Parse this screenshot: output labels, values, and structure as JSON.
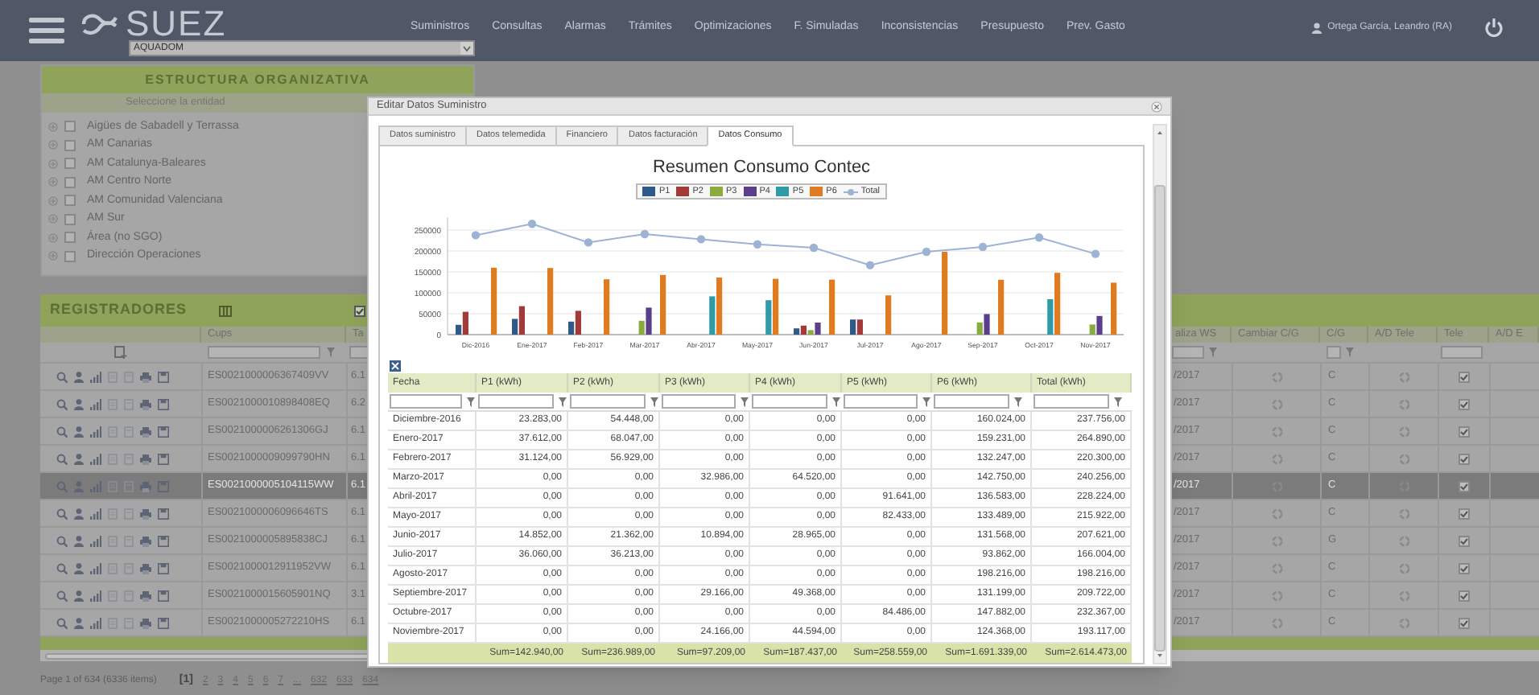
{
  "header": {
    "brand": "SUEZ",
    "org_select": "AQUADOM",
    "nav": [
      "Suministros",
      "Consultas",
      "Alarmas",
      "Trámites",
      "Optimizaciones",
      "F. Simuladas",
      "Inconsistencias",
      "Presupuesto",
      "Prev. Gasto"
    ],
    "user": "Ortega García, Leandro (RA)"
  },
  "org_panel": {
    "title": "ESTRUCTURA ORGANIZATIVA",
    "subtitle": "Seleccione la entidad",
    "items": [
      {
        "label": "Aigües de Sabadell y Terrassa",
        "checked": false
      },
      {
        "label": "AM Canarias",
        "checked": false
      },
      {
        "label": "AM Catalunya-Baleares",
        "checked": false
      },
      {
        "label": "AM Centro Norte",
        "checked": false
      },
      {
        "label": "AM Comunidad Valenciana",
        "checked": false
      },
      {
        "label": "AM Sur",
        "checked": false
      },
      {
        "label": "Área (no SGO)",
        "checked": false
      },
      {
        "label": "Dirección Operaciones",
        "checked": false
      }
    ]
  },
  "registradores": {
    "title": "REGISTRADORES",
    "cups_filter_checked": true,
    "columns": [
      "Cups",
      "Ta",
      "aliza WS",
      "Cambiar C/G",
      "C/G",
      "A/D Tele",
      "Tele",
      "A/D E"
    ],
    "rows": [
      {
        "cups": "ES0021000006367409VV",
        "ta": "6.1",
        "date": "/2017",
        "cg": "C",
        "tele": true,
        "selected": false
      },
      {
        "cups": "ES0021000010898408EQ",
        "ta": "6.2",
        "date": "/2017",
        "cg": "C",
        "tele": true,
        "selected": false
      },
      {
        "cups": "ES0021000006261306GJ",
        "ta": "6.1",
        "date": "/2017",
        "cg": "C",
        "tele": true,
        "selected": false
      },
      {
        "cups": "ES0021000009099790HN",
        "ta": "6.1",
        "date": "/2017",
        "cg": "C",
        "tele": true,
        "selected": false
      },
      {
        "cups": "ES0021000005104115WW",
        "ta": "6.1",
        "date": "/2017",
        "cg": "C",
        "tele": true,
        "selected": true
      },
      {
        "cups": "ES0021000006096646TS",
        "ta": "6.1",
        "date": "/2017",
        "cg": "C",
        "tele": true,
        "selected": false
      },
      {
        "cups": "ES0021000005895838CJ",
        "ta": "6.1",
        "date": "/2017",
        "cg": "G",
        "tele": true,
        "selected": false
      },
      {
        "cups": "ES0021000012911952VW",
        "ta": "6.1",
        "date": "/2017",
        "cg": "C",
        "tele": true,
        "selected": false
      },
      {
        "cups": "ES0021000015605901NQ",
        "ta": "3.1",
        "date": "/2017",
        "cg": "C",
        "tele": true,
        "selected": false
      },
      {
        "cups": "ES0021000005272210HS",
        "ta": "6.1",
        "date": "/2017",
        "cg": "C",
        "tele": true,
        "selected": false
      }
    ],
    "pagination": {
      "summary": "Page 1 of 634 (6336 items)",
      "pages": [
        {
          "label": "[1]",
          "selected": true
        },
        {
          "label": "2",
          "selected": false
        },
        {
          "label": "3",
          "selected": false
        },
        {
          "label": "4",
          "selected": false
        },
        {
          "label": "5",
          "selected": false
        },
        {
          "label": "6",
          "selected": false
        },
        {
          "label": "7",
          "selected": false
        },
        {
          "label": "...",
          "selected": false
        },
        {
          "label": "632",
          "selected": false
        },
        {
          "label": "633",
          "selected": false
        },
        {
          "label": "634",
          "selected": false
        }
      ]
    }
  },
  "dialog": {
    "title": "Editar Datos Suministro",
    "tabs": [
      {
        "label": "Datos suministro",
        "selected": false
      },
      {
        "label": "Datos telemedida",
        "selected": false
      },
      {
        "label": "Financiero",
        "selected": false
      },
      {
        "label": "Datos facturación",
        "selected": false
      },
      {
        "label": "Datos Consumo",
        "selected": true
      }
    ],
    "chart_data": {
      "type": "bar",
      "title": "Resumen Consumo Contec",
      "categories": [
        "Dic-2016",
        "Ene-2017",
        "Feb-2017",
        "Mar-2017",
        "Abr-2017",
        "May-2017",
        "Jun-2017",
        "Jul-2017",
        "Ago-2017",
        "Sep-2017",
        "Oct-2017",
        "Nov-2017"
      ],
      "stacked": false,
      "grid": true,
      "legend": "top",
      "ylim": [
        0,
        280000
      ],
      "yticks": [
        0,
        50000,
        100000,
        150000,
        200000,
        250000
      ],
      "series": [
        {
          "name": "P1",
          "color": "#2e5a8a",
          "values": [
            23283,
            37612,
            31124,
            0,
            0,
            0,
            14852,
            36060,
            0,
            0,
            0,
            0
          ]
        },
        {
          "name": "P2",
          "color": "#a33a3a",
          "values": [
            54448,
            68047,
            56929,
            0,
            0,
            0,
            21362,
            36213,
            0,
            0,
            0,
            0
          ]
        },
        {
          "name": "P3",
          "color": "#8aab3d",
          "values": [
            0,
            0,
            0,
            32986,
            0,
            0,
            10894,
            0,
            0,
            29166,
            0,
            24166
          ]
        },
        {
          "name": "P4",
          "color": "#5b3f8a",
          "values": [
            0,
            0,
            0,
            64520,
            0,
            0,
            28965,
            0,
            0,
            49368,
            0,
            44594
          ]
        },
        {
          "name": "P5",
          "color": "#2f9aa8",
          "values": [
            0,
            0,
            0,
            0,
            91641,
            82433,
            0,
            0,
            0,
            0,
            84486,
            0
          ]
        },
        {
          "name": "P6",
          "color": "#e07b22",
          "values": [
            160024,
            159231,
            132247,
            142750,
            136583,
            133489,
            131568,
            93862,
            198216,
            131199,
            147882,
            124368
          ]
        },
        {
          "name": "Total",
          "color": "#9db3d4",
          "type": "line",
          "marker": "circle",
          "values": [
            237756,
            264890,
            220300,
            240256,
            228224,
            215922,
            207621,
            166004,
            198216,
            209722,
            232367,
            193117
          ]
        }
      ]
    },
    "table": {
      "columns": [
        "Fecha",
        "P1 (kWh)",
        "P2 (kWh)",
        "P3 (kWh)",
        "P4 (kWh)",
        "P5 (kWh)",
        "P6 (kWh)",
        "Total (kWh)"
      ],
      "rows": [
        [
          "Diciembre-2016",
          "23.283,00",
          "54.448,00",
          "0,00",
          "0,00",
          "0,00",
          "160.024,00",
          "237.756,00"
        ],
        [
          "Enero-2017",
          "37.612,00",
          "68.047,00",
          "0,00",
          "0,00",
          "0,00",
          "159.231,00",
          "264.890,00"
        ],
        [
          "Febrero-2017",
          "31.124,00",
          "56.929,00",
          "0,00",
          "0,00",
          "0,00",
          "132.247,00",
          "220.300,00"
        ],
        [
          "Marzo-2017",
          "0,00",
          "0,00",
          "32.986,00",
          "64.520,00",
          "0,00",
          "142.750,00",
          "240.256,00"
        ],
        [
          "Abril-2017",
          "0,00",
          "0,00",
          "0,00",
          "0,00",
          "91.641,00",
          "136.583,00",
          "228.224,00"
        ],
        [
          "Mayo-2017",
          "0,00",
          "0,00",
          "0,00",
          "0,00",
          "82.433,00",
          "133.489,00",
          "215.922,00"
        ],
        [
          "Junio-2017",
          "14.852,00",
          "21.362,00",
          "10.894,00",
          "28.965,00",
          "0,00",
          "131.568,00",
          "207.621,00"
        ],
        [
          "Julio-2017",
          "36.060,00",
          "36.213,00",
          "0,00",
          "0,00",
          "0,00",
          "93.862,00",
          "166.004,00"
        ],
        [
          "Agosto-2017",
          "0,00",
          "0,00",
          "0,00",
          "0,00",
          "0,00",
          "198.216,00",
          "198.216,00"
        ],
        [
          "Septiembre-2017",
          "0,00",
          "0,00",
          "29.166,00",
          "49.368,00",
          "0,00",
          "131.199,00",
          "209.722,00"
        ],
        [
          "Octubre-2017",
          "0,00",
          "0,00",
          "0,00",
          "0,00",
          "84.486,00",
          "147.882,00",
          "232.367,00"
        ],
        [
          "Noviembre-2017",
          "0,00",
          "0,00",
          "24.166,00",
          "44.594,00",
          "0,00",
          "124.368,00",
          "193.117,00"
        ]
      ],
      "sums": [
        "Sum=142.940,00",
        "Sum=236.989,00",
        "Sum=97.209,00",
        "Sum=187.437,00",
        "Sum=258.559,00",
        "Sum=1.691.339,00",
        "Sum=2.614.473,00"
      ]
    }
  }
}
